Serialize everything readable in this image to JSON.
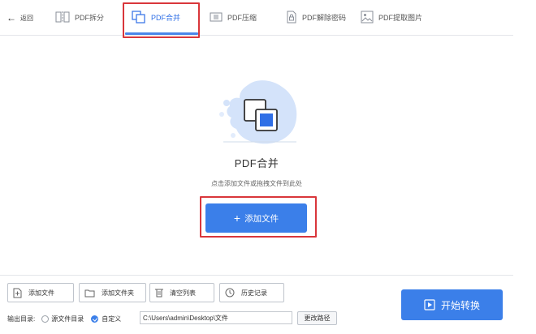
{
  "topbar": {
    "back_label": "返回",
    "tabs": [
      {
        "label": "PDF拆分",
        "icon": "split-icon"
      },
      {
        "label": "PDF合并",
        "icon": "merge-icon",
        "active": true
      },
      {
        "label": "PDF压缩",
        "icon": "compress-icon"
      },
      {
        "label": "PDF解除密码",
        "icon": "unlock-icon"
      },
      {
        "label": "PDF提取图片",
        "icon": "image-icon"
      }
    ]
  },
  "main": {
    "title": "PDF合并",
    "hint": "点击添加文件或拖拽文件到此处",
    "add_button_label": "添加文件"
  },
  "bottom": {
    "tools": [
      {
        "label": "添加文件",
        "icon": "add-file-icon"
      },
      {
        "label": "添加文件夹",
        "icon": "add-folder-icon"
      },
      {
        "label": "清空列表",
        "icon": "trash-icon"
      },
      {
        "label": "历史记录",
        "icon": "clock-icon"
      }
    ],
    "output_label": "输出目录:",
    "option_source": "源文件目录",
    "option_custom": "自定义",
    "selected_option": "自定义",
    "output_path": "C:\\Users\\admin\\Desktop\\文件",
    "change_path_label": "更改路径",
    "start_label": "开始转换"
  },
  "colors": {
    "accent": "#3b7fe9",
    "highlight_box": "#d9363b"
  }
}
